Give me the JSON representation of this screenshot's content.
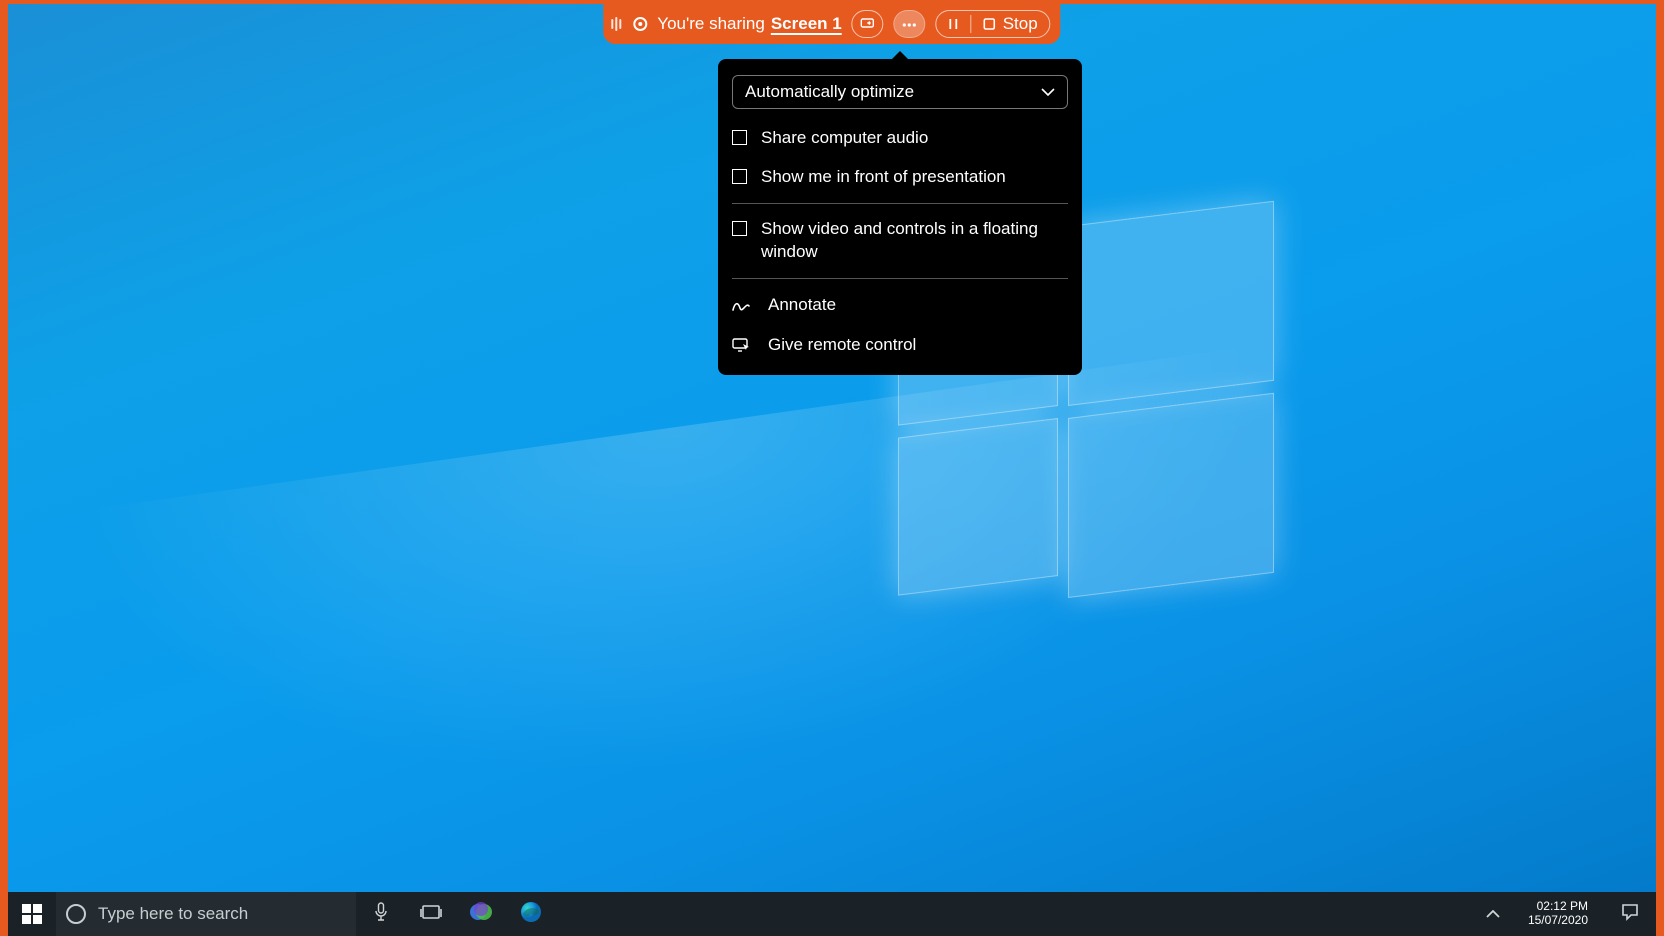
{
  "sharebar": {
    "status_text": "You're sharing",
    "screen_label": "Screen 1",
    "stop_label": "Stop"
  },
  "popup": {
    "select_value": "Automatically optimize",
    "options": {
      "share_audio": "Share computer audio",
      "show_me_front": "Show me in front of presentation",
      "floating_window": "Show video and controls in a floating window"
    },
    "actions": {
      "annotate": "Annotate",
      "remote_control": "Give remote control"
    }
  },
  "taskbar": {
    "search_placeholder": "Type here to search",
    "clock": {
      "time": "02:12 PM",
      "date": "15/07/2020"
    }
  }
}
